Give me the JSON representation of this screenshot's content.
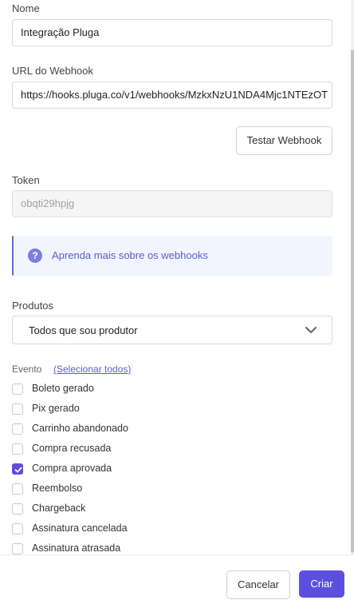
{
  "form": {
    "name_label": "Nome",
    "name_value": "Integração Pluga",
    "url_label": "URL do Webhook",
    "url_value": "https://hooks.pluga.co/v1/webhooks/MzkxNzU1NDA4Mjc1NTEzOT",
    "test_button": "Testar Webhook",
    "token_label": "Token",
    "token_value": "obqti29hpjg",
    "info_text": "Aprenda mais sobre os webhooks",
    "info_icon": "question-circle-icon",
    "products_label": "Produtos",
    "products_value": "Todos que sou produtor",
    "event_label": "Evento",
    "select_all": "(Selecionar todos)",
    "events": [
      {
        "label": "Boleto gerado",
        "checked": false
      },
      {
        "label": "Pix gerado",
        "checked": false
      },
      {
        "label": "Carrinho abandonado",
        "checked": false
      },
      {
        "label": "Compra recusada",
        "checked": false
      },
      {
        "label": "Compra aprovada",
        "checked": true
      },
      {
        "label": "Reembolso",
        "checked": false
      },
      {
        "label": "Chargeback",
        "checked": false
      },
      {
        "label": "Assinatura cancelada",
        "checked": false
      },
      {
        "label": "Assinatura atrasada",
        "checked": false
      }
    ]
  },
  "footer": {
    "cancel": "Cancelar",
    "submit": "Criar"
  },
  "colors": {
    "accent": "#5b4fe0",
    "info_bg": "#f2f5fd"
  }
}
